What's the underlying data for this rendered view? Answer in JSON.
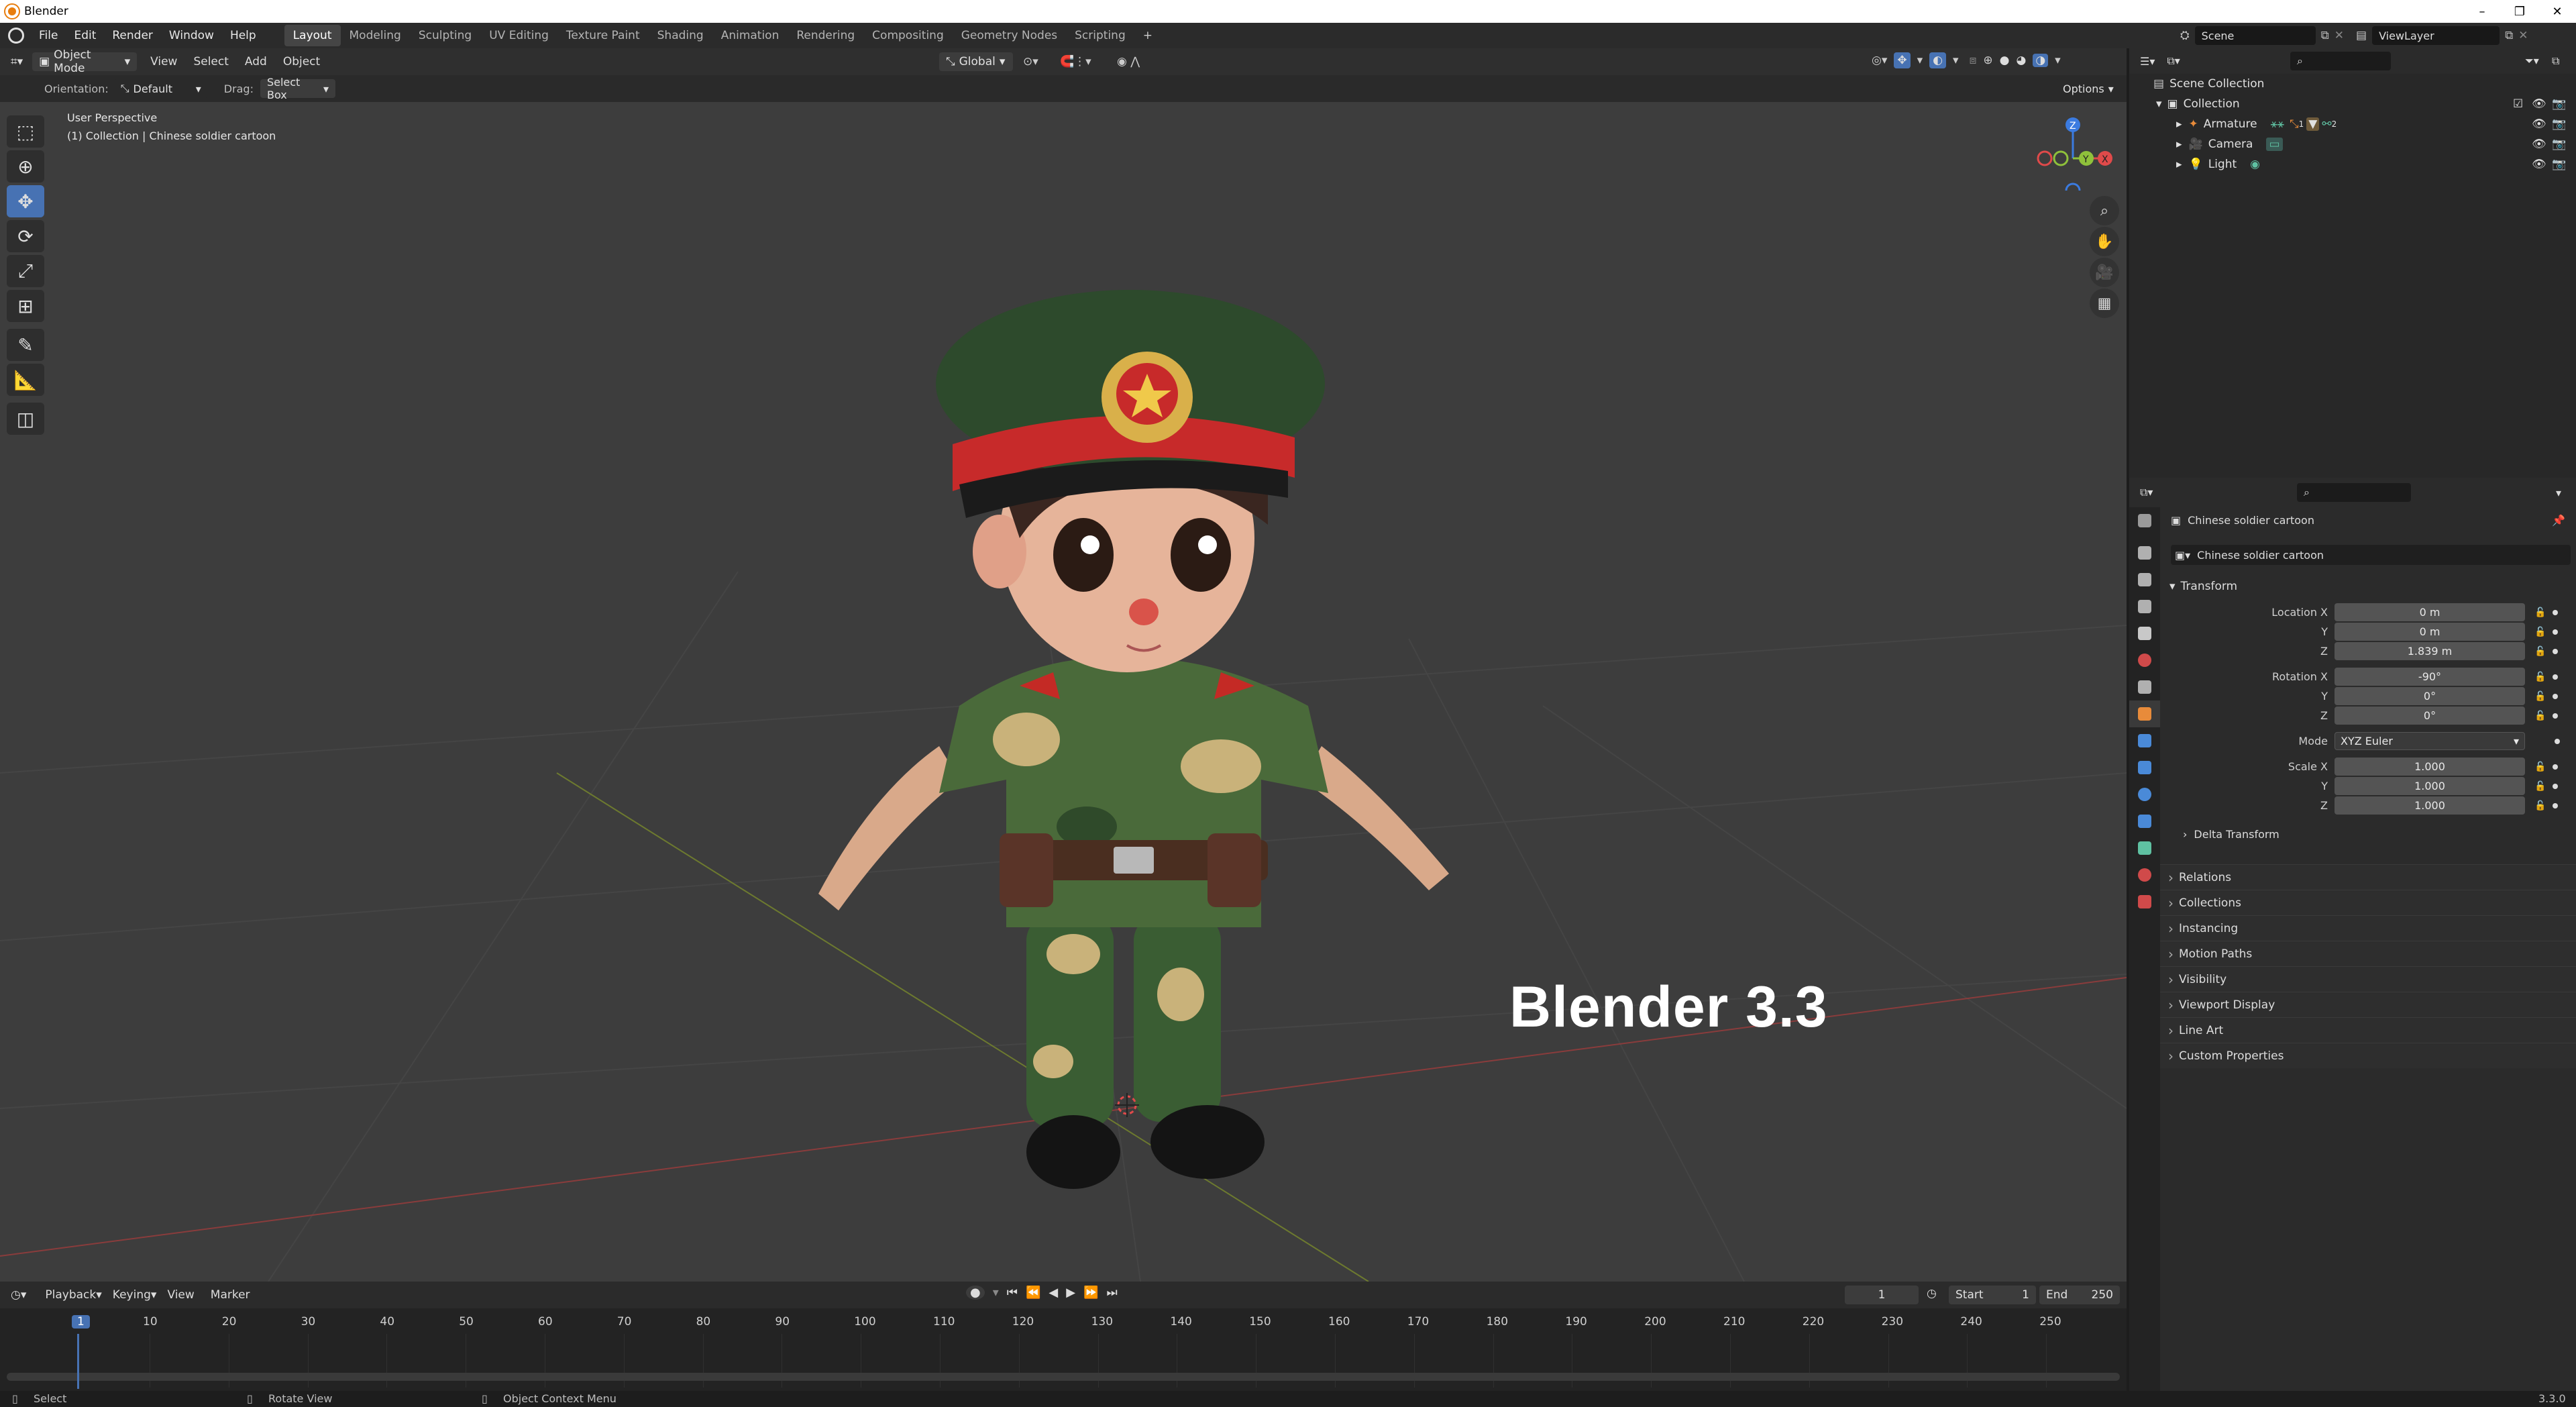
{
  "window": {
    "title": "Blender"
  },
  "menu": [
    "File",
    "Edit",
    "Render",
    "Window",
    "Help"
  ],
  "workspaces": {
    "tabs": [
      "Layout",
      "Modeling",
      "Sculpting",
      "UV Editing",
      "Texture Paint",
      "Shading",
      "Animation",
      "Rendering",
      "Compositing",
      "Geometry Nodes",
      "Scripting"
    ],
    "active": "Layout",
    "add": "+"
  },
  "scene": {
    "label": "Scene",
    "viewlayer": "ViewLayer"
  },
  "viewport_header": {
    "mode": "Object Mode",
    "menus": [
      "View",
      "Select",
      "Add",
      "Object"
    ],
    "transform_orientation": "Global",
    "options": "Options",
    "orientation_label": "Orientation:",
    "orientation_value": "Default",
    "drag_label": "Drag:",
    "drag_value": "Select Box"
  },
  "viewport": {
    "perspective": "User Perspective",
    "collection_info": "(1) Collection | Chinese soldier cartoon",
    "overlay_title": "Blender 3.3",
    "gizmo": {
      "z": "Z",
      "y": "Y",
      "x": "X"
    }
  },
  "outliner": {
    "root": "Scene Collection",
    "collection": "Collection",
    "items": [
      {
        "name": "Armature",
        "icon": "armature-icon",
        "color": "#e88b3a"
      },
      {
        "name": "Camera",
        "icon": "camera-icon",
        "color": "#e88b3a"
      },
      {
        "name": "Light",
        "icon": "light-icon",
        "color": "#e88b3a"
      }
    ],
    "armature_badge_1": "1",
    "armature_badge_2": "2"
  },
  "properties": {
    "object_name": "Chinese soldier cartoon",
    "data_name": "Chinese soldier cartoon",
    "transform_title": "Transform",
    "location": {
      "label": "Location X",
      "x": "0 m",
      "y": "0 m",
      "z": "1.839 m"
    },
    "rotation": {
      "label": "Rotation X",
      "x": "-90°",
      "y": "0°",
      "z": "0°"
    },
    "mode": {
      "label": "Mode",
      "value": "XYZ Euler"
    },
    "scale": {
      "label": "Scale X",
      "x": "1.000",
      "y": "1.000",
      "z": "1.000"
    },
    "axis_y": "Y",
    "axis_z": "Z",
    "delta": "Delta Transform",
    "sections": [
      "Relations",
      "Collections",
      "Instancing",
      "Motion Paths",
      "Visibility",
      "Viewport Display",
      "Line Art",
      "Custom Properties"
    ]
  },
  "timeline": {
    "menus": [
      "Playback",
      "Keying",
      "View",
      "Marker"
    ],
    "current_frame": "1",
    "start_label": "Start",
    "start": "1",
    "end_label": "End",
    "end": "250",
    "ticks": [
      "1",
      "10",
      "20",
      "30",
      "40",
      "50",
      "60",
      "70",
      "80",
      "90",
      "100",
      "110",
      "120",
      "130",
      "140",
      "150",
      "160",
      "170",
      "180",
      "190",
      "200",
      "210",
      "220",
      "230",
      "240",
      "250"
    ]
  },
  "statusbar": {
    "select": "Select",
    "rotate": "Rotate View",
    "context": "Object Context Menu",
    "version": "3.3.0"
  },
  "colors": {
    "accent": "#4772b3",
    "object_orange": "#e88b3a",
    "x_axis": "#e04a4a",
    "y_axis": "#8fc13b",
    "z_axis": "#3b7be0"
  }
}
